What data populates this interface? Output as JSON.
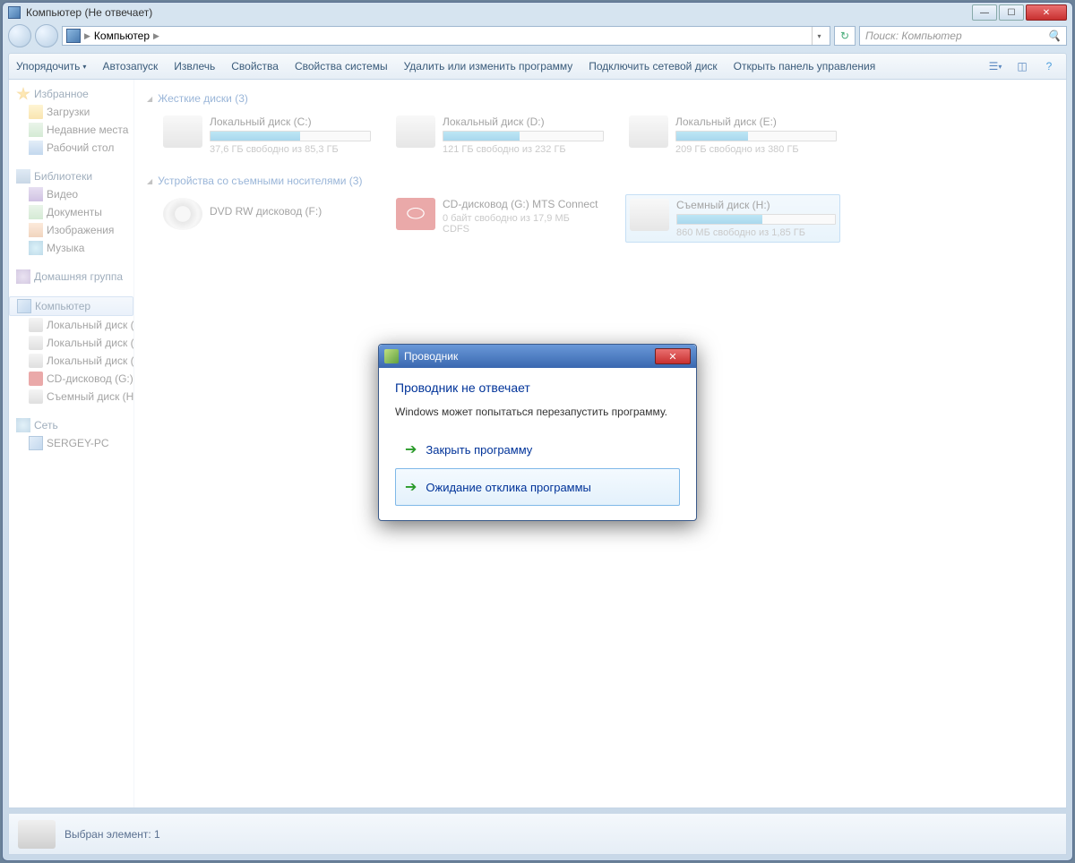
{
  "title": "Компьютер (Не отвечает)",
  "breadcrumb": {
    "root": "Компьютер"
  },
  "search": {
    "placeholder": "Поиск: Компьютер"
  },
  "toolbar": {
    "organize": "Упорядочить",
    "autoplay": "Автозапуск",
    "eject": "Извлечь",
    "properties": "Свойства",
    "sysprops": "Свойства системы",
    "uninstall": "Удалить или изменить программу",
    "mapdrive": "Подключить сетевой диск",
    "ctrlpanel": "Открыть панель управления"
  },
  "sidebar": {
    "favorites": {
      "label": "Избранное",
      "items": [
        {
          "label": "Загрузки"
        },
        {
          "label": "Недавние места"
        },
        {
          "label": "Рабочий стол"
        }
      ]
    },
    "libraries": {
      "label": "Библиотеки",
      "items": [
        {
          "label": "Видео"
        },
        {
          "label": "Документы"
        },
        {
          "label": "Изображения"
        },
        {
          "label": "Музыка"
        }
      ]
    },
    "homegroup": {
      "label": "Домашняя группа"
    },
    "computer": {
      "label": "Компьютер",
      "items": [
        {
          "label": "Локальный диск (C:)"
        },
        {
          "label": "Локальный диск (D:)"
        },
        {
          "label": "Локальный диск (E:)"
        },
        {
          "label": "CD-дисковод (G:) MTS"
        },
        {
          "label": "Съемный диск (H:)"
        }
      ]
    },
    "network": {
      "label": "Сеть",
      "items": [
        {
          "label": "SERGEY-PC"
        }
      ]
    }
  },
  "groups": {
    "hdd": {
      "label": "Жесткие диски (3)",
      "drives": [
        {
          "name": "Локальный диск (C:)",
          "sub": "37,6 ГБ свободно из 85,3 ГБ",
          "fill": 56
        },
        {
          "name": "Локальный диск  (D:)",
          "sub": "121 ГБ свободно из 232 ГБ",
          "fill": 48
        },
        {
          "name": "Локальный диск (E:)",
          "sub": "209 ГБ свободно из 380 ГБ",
          "fill": 45
        }
      ]
    },
    "removable": {
      "label": "Устройства со съемными носителями (3)",
      "drives": [
        {
          "name": "DVD RW дисковод (F:)",
          "type": "dvd"
        },
        {
          "name": "CD-дисковод (G:) MTS Connect",
          "sub": "0 байт свободно из 17,9 МБ",
          "sub2": "CDFS",
          "type": "mts"
        },
        {
          "name": "Съемный диск (H:)",
          "sub": "860 МБ свободно из 1,85 ГБ",
          "fill": 54,
          "selected": true
        }
      ]
    }
  },
  "statusbar": {
    "text": "Выбран элемент: 1"
  },
  "dialog": {
    "title": "Проводник",
    "heading": "Проводник не отвечает",
    "message": "Windows может попытаться перезапустить программу.",
    "opt_close": "Закрыть программу",
    "opt_wait": "Ожидание отклика программы"
  }
}
